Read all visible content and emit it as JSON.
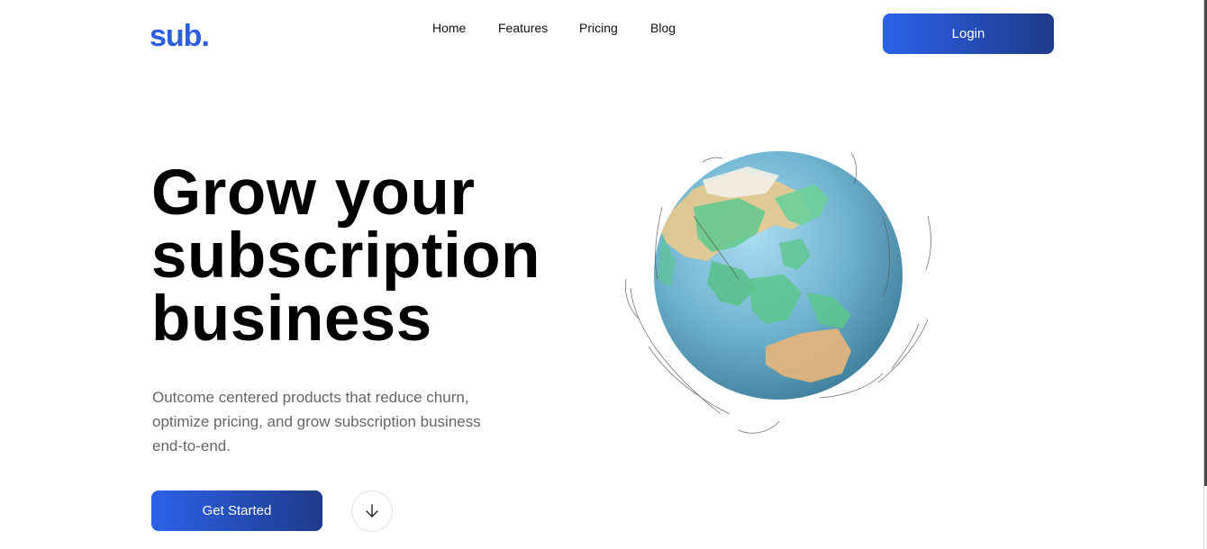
{
  "header": {
    "logo": "sub.",
    "nav": [
      {
        "label": "Home"
      },
      {
        "label": "Features"
      },
      {
        "label": "Pricing"
      },
      {
        "label": "Blog"
      }
    ],
    "login_label": "Login"
  },
  "hero": {
    "title_lines": [
      "Grow your",
      "subscription",
      "business"
    ],
    "subtitle_lines": [
      "Outcome centered products that reduce churn,",
      "optimize pricing, and grow subscription business",
      "end-to-end."
    ],
    "cta_label": "Get Started",
    "scroll_icon": "arrow-down-icon",
    "illustration": "globe-illustration"
  },
  "colors": {
    "brand": "#2b5fe0",
    "button_gradient_start": "#2c62e8",
    "button_gradient_end": "#1e3a8a",
    "subtitle_text": "#666666"
  }
}
